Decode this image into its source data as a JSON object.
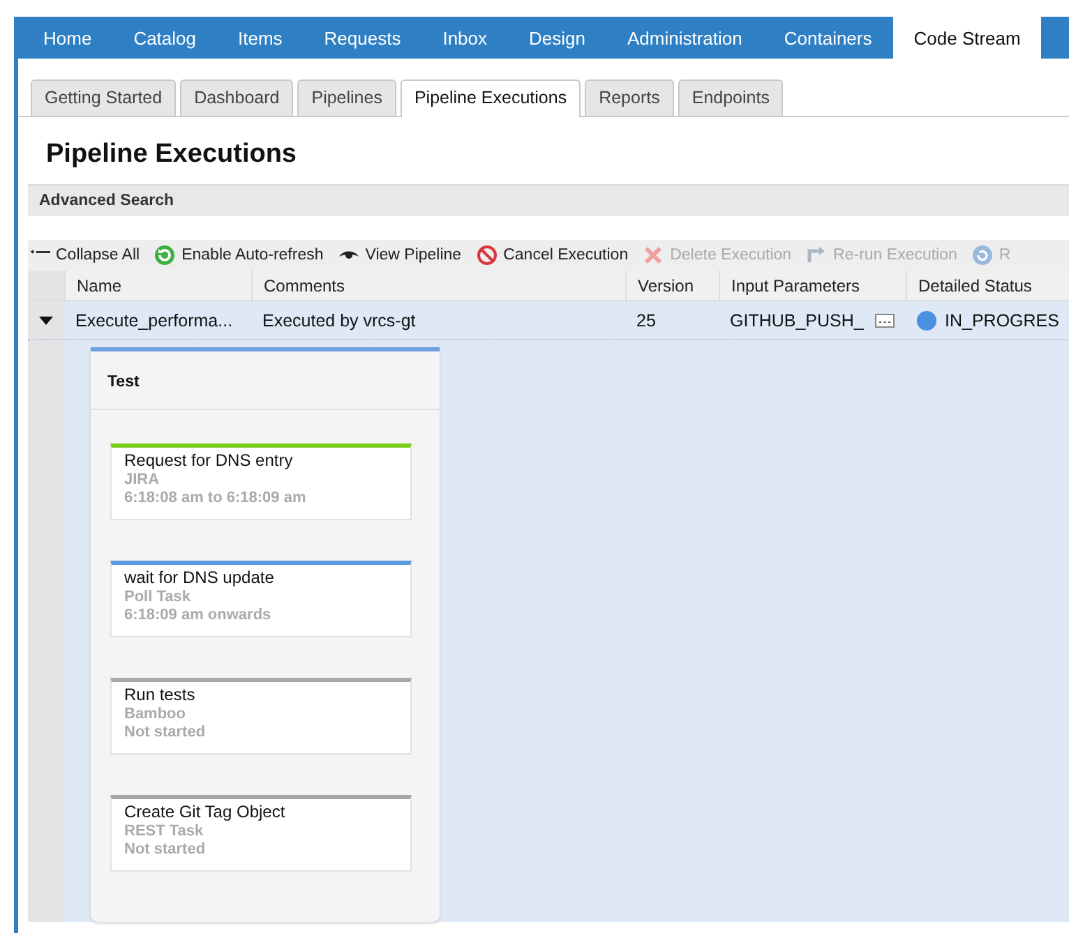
{
  "nav_tabs": [
    {
      "label": "Home",
      "selected": false
    },
    {
      "label": "Catalog",
      "selected": false
    },
    {
      "label": "Items",
      "selected": false
    },
    {
      "label": "Requests",
      "selected": false
    },
    {
      "label": "Inbox",
      "selected": false
    },
    {
      "label": "Design",
      "selected": false
    },
    {
      "label": "Administration",
      "selected": false
    },
    {
      "label": "Containers",
      "selected": false
    },
    {
      "label": "Code Stream",
      "selected": true
    }
  ],
  "sub_tabs": [
    {
      "label": "Getting Started",
      "selected": false
    },
    {
      "label": "Dashboard",
      "selected": false
    },
    {
      "label": "Pipelines",
      "selected": false
    },
    {
      "label": "Pipeline Executions",
      "selected": true
    },
    {
      "label": "Reports",
      "selected": false
    },
    {
      "label": "Endpoints",
      "selected": false
    }
  ],
  "page_title": "Pipeline Executions",
  "advanced_search": "Advanced Search",
  "toolbar": [
    {
      "kind": "collapse",
      "label": "Collapse All",
      "disabled": false
    },
    {
      "kind": "refresh",
      "label": "Enable Auto-refresh",
      "disabled": false
    },
    {
      "kind": "view",
      "label": "View Pipeline",
      "disabled": false
    },
    {
      "kind": "cancel",
      "label": "Cancel Execution",
      "disabled": false
    },
    {
      "kind": "delete",
      "label": "Delete Execution",
      "disabled": true
    },
    {
      "kind": "rerun",
      "label": "Re-run Execution",
      "disabled": true
    },
    {
      "kind": "resume",
      "label": "R",
      "disabled": true
    }
  ],
  "table": {
    "columns": [
      "Name",
      "Comments",
      "Version",
      "Input Parameters",
      "Detailed Status"
    ],
    "rows": [
      {
        "expanded": true,
        "name": "Execute_performa...",
        "comments": "Executed by vrcs-gt",
        "version": "25",
        "input_parameters": "GITHUB_PUSH_",
        "status": "IN_PROGRES",
        "color": "#4a8fe0"
      }
    ]
  },
  "stage": {
    "title": "Test",
    "tasks": [
      {
        "name": "Request for DNS entry",
        "type": "JIRA",
        "time": "6:18:08 am to 6:18:09 am",
        "kind": "completed"
      },
      {
        "name": "wait for DNS update",
        "type": "Poll Task",
        "time": "6:18:09 am onwards",
        "kind": "running"
      },
      {
        "name": "Run tests",
        "type": "Bamboo",
        "time": "Not started",
        "kind": "pending"
      },
      {
        "name": "Create Git Tag Object",
        "type": "REST Task",
        "time": "Not started",
        "kind": "pending"
      }
    ]
  }
}
